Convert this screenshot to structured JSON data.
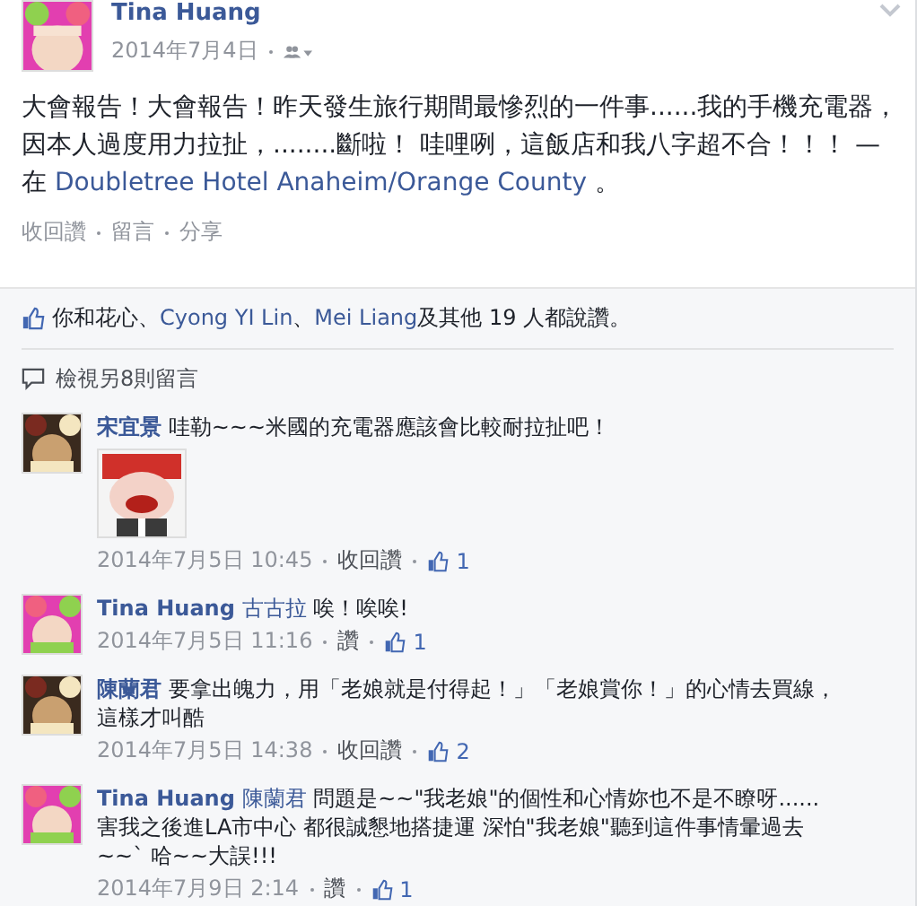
{
  "post": {
    "author": "Tina Huang",
    "avatar": {
      "kind": "picture"
    },
    "date": "2014年7月4日",
    "body": "大會報告！大會報告！昨天發生旅行期間最慘烈的一件事......我的手機充電器，因本人過度用力拉扯，........斷啦！ 哇哩咧，這飯店和我八字超不合！！！",
    "place_prefix": "— 在",
    "place": "Doubletree Hotel Anaheim/Orange County",
    "place_suffix": "。",
    "actions": [
      "收回讚",
      "留言",
      "分享"
    ]
  },
  "likes": {
    "parts": [
      {
        "text": "你和花心、",
        "kind": "text"
      },
      {
        "text": "Cyong YI Lin",
        "kind": "link"
      },
      {
        "text": "、",
        "kind": "text"
      },
      {
        "text": "Mei Liang",
        "kind": "link"
      },
      {
        "text": "及其他 19 人都說讚。",
        "kind": "text"
      }
    ]
  },
  "more_comments": "檢視另8則留言",
  "comments": [
    {
      "author": "宋宜景",
      "avatar": {
        "kind": "picture"
      },
      "text": "哇勒~~~米國的充電器應該會比較耐拉扯吧！",
      "attachment": {
        "kind": "picture"
      },
      "date": "2014年7月5日 10:45",
      "action": "收回讚",
      "likes": "1"
    },
    {
      "author": "Tina Huang",
      "avatar": {
        "kind": "picture"
      },
      "mention": "古古拉",
      "text": "唉！唉唉!",
      "date": "2014年7月5日 11:16",
      "action": "讚",
      "likes": "1"
    },
    {
      "author": "陳蘭君",
      "avatar": {
        "kind": "picture"
      },
      "text": "要拿出魄力，用「老娘就是付得起！」「老娘賞你！」的心情去買線，這樣才叫酷",
      "date": "2014年7月5日 14:38",
      "action": "收回讚",
      "likes": "2"
    },
    {
      "author": "Tina Huang",
      "avatar": {
        "kind": "picture"
      },
      "mention": "陳蘭君",
      "text": "問題是~~\"我老娘\"的個性和心情妳也不是不瞭呀...... 害我之後進LA市中心 都很誠懇地搭捷運 深怕\"我老娘\"聽到這件事情暈過去~~` 哈~~大誤!!!",
      "date": "2014年7月9日 2:14",
      "action": "讚",
      "likes": "1"
    }
  ]
}
